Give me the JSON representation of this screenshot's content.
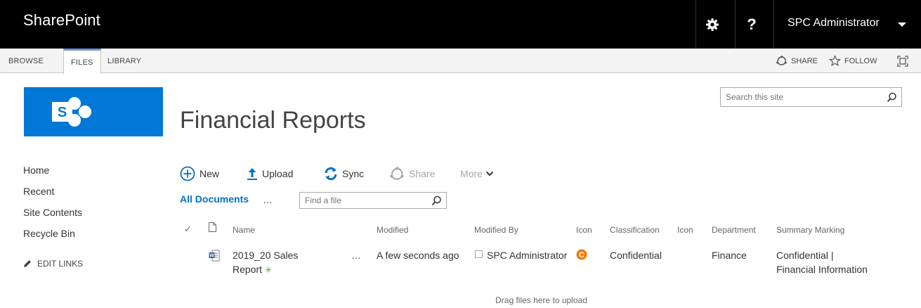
{
  "suite_bar": {
    "brand": "SharePoint",
    "settings_icon": "gear-icon",
    "help_label": "?",
    "user_name": "SPC Administrator",
    "background": "#000000"
  },
  "ribbon": {
    "tabs": [
      {
        "label": "BROWSE"
      },
      {
        "label": "FILES"
      },
      {
        "label": "LIBRARY"
      }
    ],
    "share_label": "SHARE",
    "follow_label": "FOLLOW"
  },
  "site": {
    "title": "Financial Reports",
    "logo_letter": "S",
    "logo_color": "#0078d7"
  },
  "search": {
    "placeholder": "Search this site"
  },
  "leftnav": {
    "items": [
      {
        "label": "Home"
      },
      {
        "label": "Recent"
      },
      {
        "label": "Site Contents"
      },
      {
        "label": "Recycle Bin"
      }
    ],
    "edit_links": "EDIT LINKS"
  },
  "commands": {
    "new": "New",
    "upload": "Upload",
    "sync": "Sync",
    "share": "Share",
    "more": "More"
  },
  "view": {
    "name": "All Documents",
    "dots": "…",
    "find_placeholder": "Find a file"
  },
  "table": {
    "headers": {
      "check": "✓",
      "name": "Name",
      "modified": "Modified",
      "modified_by": "Modified By",
      "icon1": "Icon",
      "classification": "Classification",
      "icon2": "Icon",
      "department": "Department",
      "summary_marking": "Summary Marking"
    },
    "rows": [
      {
        "name_line1": "2019_20 Sales",
        "name_line2": "Report",
        "new_marker": "✳",
        "dots": "…",
        "modified": "A few seconds ago",
        "modified_by": "SPC Administrator",
        "classification_icon_letter": "C",
        "classification": "Confidential",
        "department": "Finance",
        "summary_line1": "Confidential |",
        "summary_line2": "Financial Information"
      }
    ]
  },
  "drag_hint": "Drag files here to upload",
  "colors": {
    "accent": "#0072c6",
    "classification_badge": "#f07c00",
    "new_marker": "#4f9d2d",
    "word_icon": "#2b579a"
  }
}
